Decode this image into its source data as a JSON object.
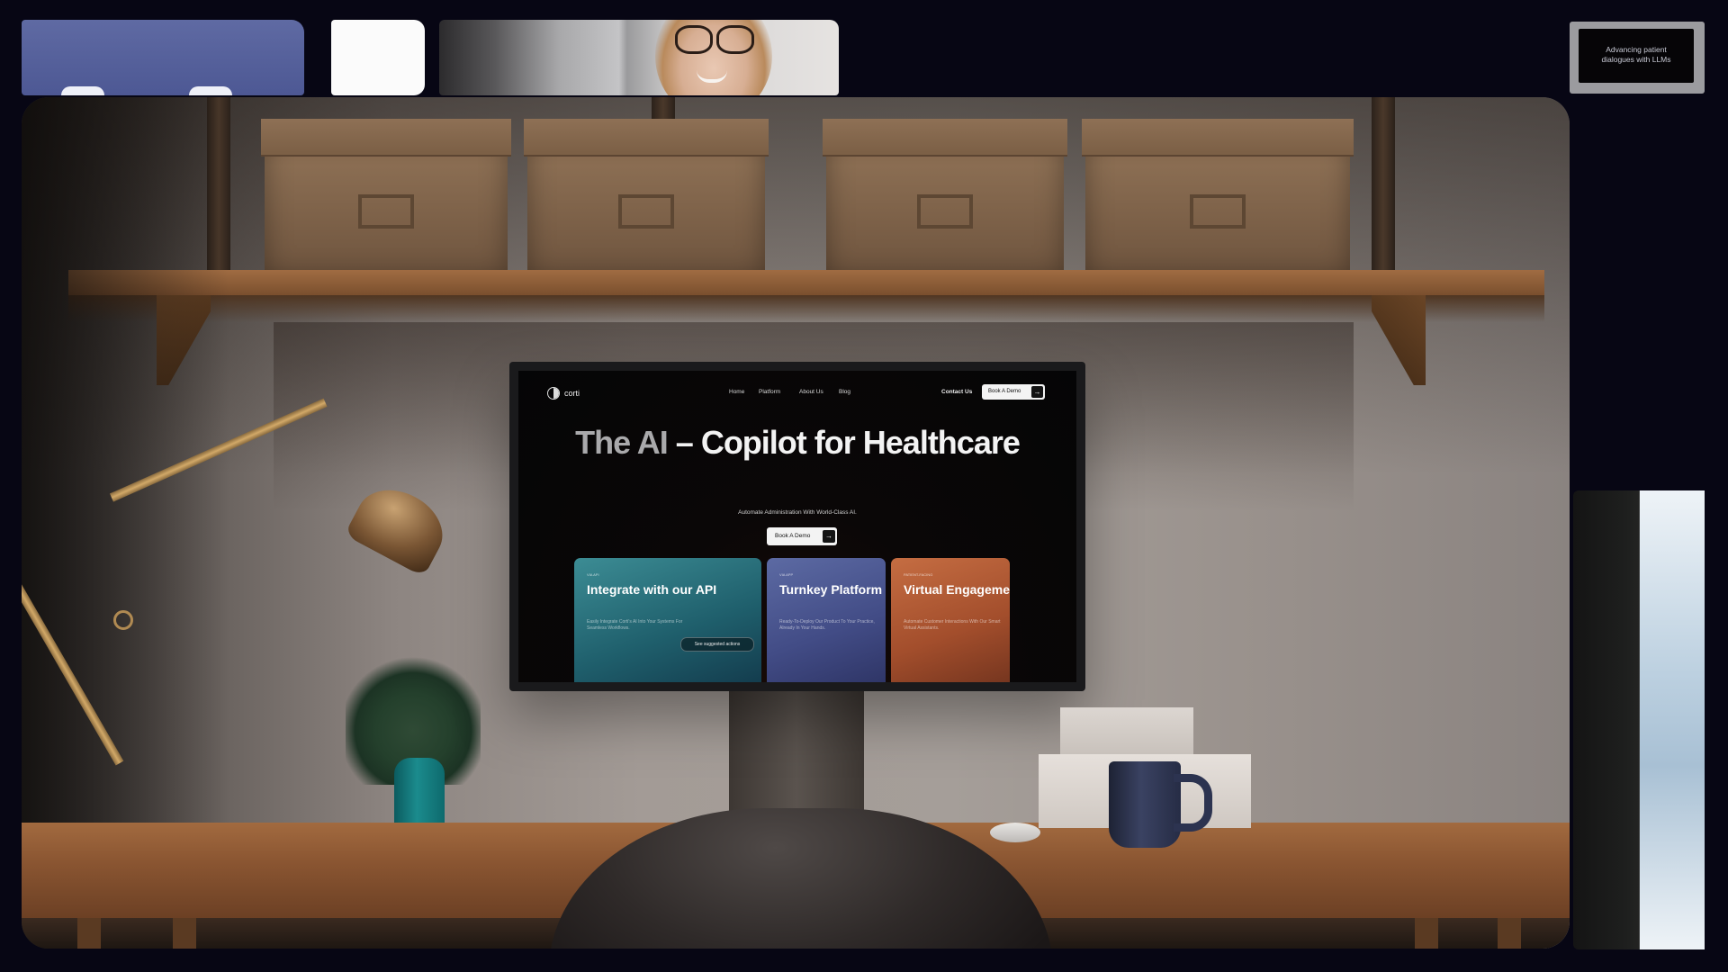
{
  "thumbnails": {
    "preview_caption": "Advancing patient dialogues with LLMs"
  },
  "website": {
    "logo_text": "corti",
    "nav": [
      "Home",
      "Platform",
      "About Us",
      "Blog"
    ],
    "contact_label": "Contact Us",
    "demo_label": "Book A Demo",
    "hero": {
      "title_dim": "The AI",
      "title_main": " – Copilot for Healthcare",
      "subtitle": "Automate Administration With World-Class AI.",
      "cta_label": "Book A Demo"
    },
    "cards": [
      {
        "eyebrow": "Via API",
        "title": "Integrate with our API",
        "desc": "Easily Integrate Corti's AI Into Your Systems For Seamless Workflows.",
        "chip": "See suggested actions"
      },
      {
        "eyebrow": "Via app",
        "title": "Turnkey Platform",
        "desc": "Ready-To-Deploy Our Product To Your Practice, Already In Your Hands."
      },
      {
        "eyebrow": "Patient-facing",
        "title": "Virtual Engagement",
        "desc": "Automate Customer Interactions With Our Smart Virtual Assistants."
      }
    ]
  },
  "icons": {
    "arrow": "→"
  },
  "colors": {
    "card_api": "#1f5f6c",
    "card_turnkey": "#424c86",
    "card_virtual": "#a34e2c",
    "background": "#070614"
  }
}
